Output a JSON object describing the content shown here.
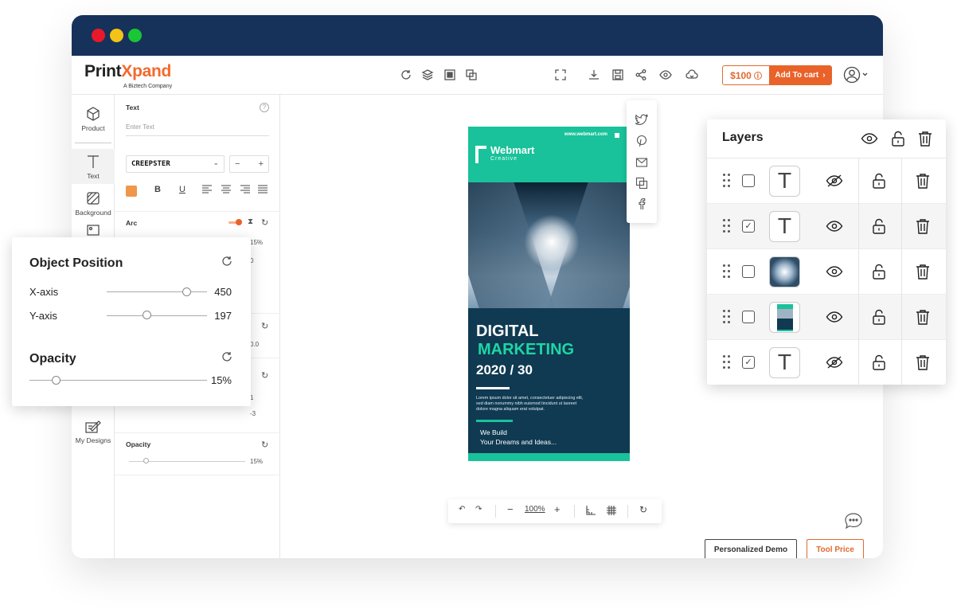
{
  "app": {
    "logo_main": "Print",
    "logo_x": "X",
    "logo_rest": "pand",
    "logo_sub": "A Biztech Company"
  },
  "toolbar": {
    "price": "$100",
    "add_to_cart": "Add To cart"
  },
  "leftnav": {
    "items": [
      {
        "label": "Product",
        "icon": "cube-icon"
      },
      {
        "label": "Text",
        "icon": "text-icon"
      },
      {
        "label": "Background",
        "icon": "background-icon"
      },
      {
        "label": "My Designs",
        "icon": "my-designs-icon"
      }
    ]
  },
  "text_panel": {
    "title": "Text",
    "placeholder": "Enter Text",
    "font": "CREEPSTER",
    "stepper_minus": "−",
    "stepper_plus": "+",
    "arc_label": "Arc",
    "arc_pct": "15%",
    "arc_val": "0",
    "val_a": "0.0",
    "val_b": "1",
    "val_c": "-3",
    "opacity_label": "Opacity",
    "opacity_pct": "15%"
  },
  "flyer": {
    "site": "www.webmart.com",
    "brand": "Webmart",
    "brand_sub": "Creative",
    "headline_1": "DIGITAL",
    "headline_2": "MARKETING",
    "headline_3": "2020 / 30",
    "body": "Lorem ipsum dolor sit amet, consectetuer adipiscing elit, sed diam nonummy nibh euismod tincidunt ut laoreet dolore magna aliquam erat volutpat.",
    "tagline_1": "We Build",
    "tagline_2": "Your Dreams and Ideas..."
  },
  "zoom": {
    "minus": "−",
    "level": "100%",
    "plus": "+"
  },
  "buttons": {
    "demo": "Personalized Demo",
    "tool_price": "Tool Price"
  },
  "object_position": {
    "title": "Object Position",
    "x_label": "X-axis",
    "x_value": "450",
    "y_label": "Y-axis",
    "y_value": "197",
    "opacity_title": "Opacity",
    "opacity_value": "15%"
  },
  "layers": {
    "title": "Layers",
    "rows": [
      {
        "type": "text",
        "checked": false,
        "visible": false
      },
      {
        "type": "text",
        "checked": true,
        "visible": true
      },
      {
        "type": "image",
        "checked": false,
        "visible": true
      },
      {
        "type": "flyer",
        "checked": false,
        "visible": true
      },
      {
        "type": "text",
        "checked": true,
        "visible": false
      }
    ]
  },
  "colors": {
    "brand_orange": "#e9622a",
    "titlebar": "#17325a",
    "flyer_green": "#19c29a",
    "flyer_navy": "#0f3a52"
  }
}
